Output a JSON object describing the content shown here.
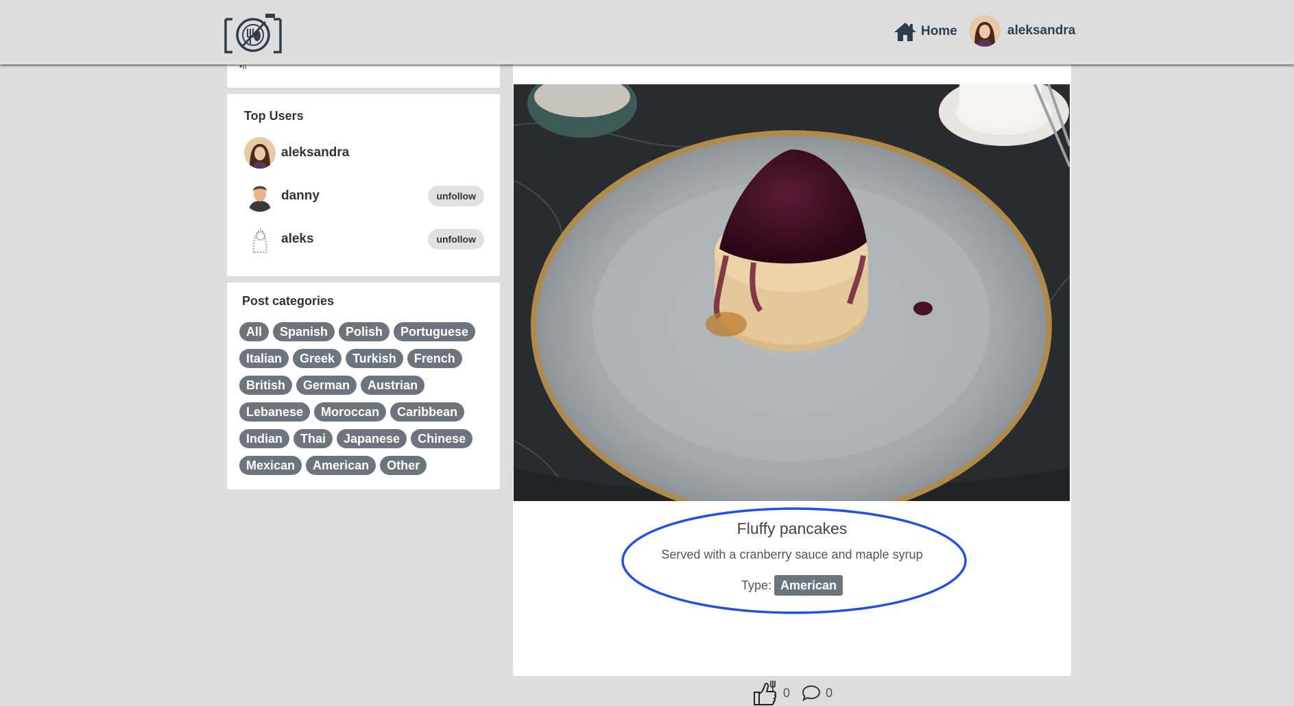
{
  "header": {
    "logo_icon": "camera-plate-cutlery-icon",
    "home_label": "Home",
    "home_icon": "house-icon",
    "username": "aleksandra"
  },
  "sidebar": {
    "top_users": {
      "title": "Top Users",
      "users": [
        {
          "name": "aleksandra",
          "action": ""
        },
        {
          "name": "danny",
          "action": "unfollow"
        },
        {
          "name": "aleks",
          "action": "unfollow"
        }
      ]
    },
    "categories": {
      "title": "Post categories",
      "items": [
        "All",
        "Spanish",
        "Polish",
        "Portuguese",
        "Italian",
        "Greek",
        "Turkish",
        "French",
        "British",
        "German",
        "Austrian",
        "Lebanese",
        "Moroccan",
        "Caribbean",
        "Indian",
        "Thai",
        "Japanese",
        "Chinese",
        "Mexican",
        "American",
        "Other"
      ]
    }
  },
  "post": {
    "title": "Fluffy pancakes",
    "description": "Served with a cranberry sauce and maple syrup",
    "type_label": "Type:",
    "type_value": "American",
    "likes": "0",
    "comments": "0"
  },
  "colors": {
    "background": "#dcdddc",
    "pill": "#6c757d",
    "highlight": "#2250e6"
  }
}
